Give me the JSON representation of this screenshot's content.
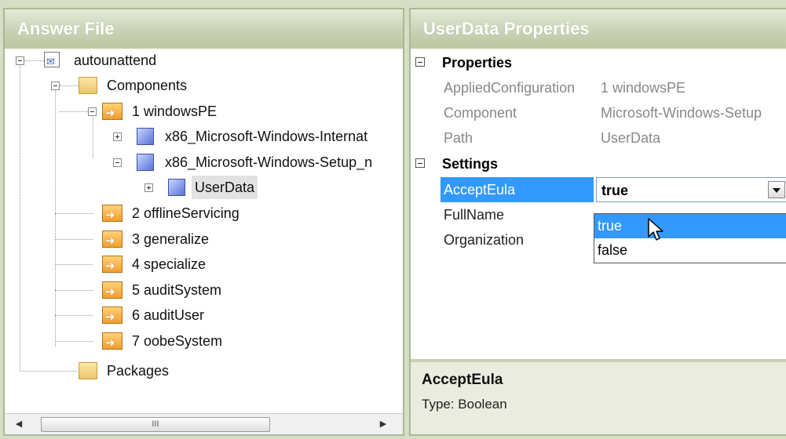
{
  "answer_file": {
    "title": "Answer File",
    "tree": [
      {
        "label": "autounattend",
        "icon": "answer-file-icon"
      },
      {
        "label": "Components",
        "icon": "folder-icon"
      },
      {
        "label": "1 windowsPE",
        "icon": "pass-icon"
      },
      {
        "label": "x86_Microsoft-Windows-Internat",
        "icon": "component-icon"
      },
      {
        "label": "x86_Microsoft-Windows-Setup_n",
        "icon": "component-icon"
      },
      {
        "label": "UserData",
        "icon": "component-icon",
        "selected": true
      },
      {
        "label": "2 offlineServicing",
        "icon": "pass-icon"
      },
      {
        "label": "3 generalize",
        "icon": "pass-icon"
      },
      {
        "label": "4 specialize",
        "icon": "pass-icon"
      },
      {
        "label": "5 auditSystem",
        "icon": "pass-icon"
      },
      {
        "label": "6 auditUser",
        "icon": "pass-icon"
      },
      {
        "label": "7 oobeSystem",
        "icon": "pass-icon"
      },
      {
        "label": "Packages",
        "icon": "folder-icon"
      }
    ],
    "scroll_thumb_grip": "III"
  },
  "properties": {
    "title": "UserData Properties",
    "category_properties": "Properties",
    "applied_configuration": {
      "name": "AppliedConfiguration",
      "value": "1 windowsPE"
    },
    "component": {
      "name": "Component",
      "value": "Microsoft-Windows-Setup"
    },
    "path": {
      "name": "Path",
      "value": "UserData"
    },
    "category_settings": "Settings",
    "accept_eula": {
      "name": "AcceptEula",
      "value": "true"
    },
    "full_name": {
      "name": "FullName"
    },
    "organization": {
      "name": "Organization"
    },
    "dropdown_options": [
      "true",
      "false"
    ]
  },
  "description": {
    "title": "AcceptEula",
    "text": "Type: Boolean"
  },
  "colors": {
    "selection": "#3399ff",
    "header_gradient_bottom": "#bcc7a4"
  }
}
